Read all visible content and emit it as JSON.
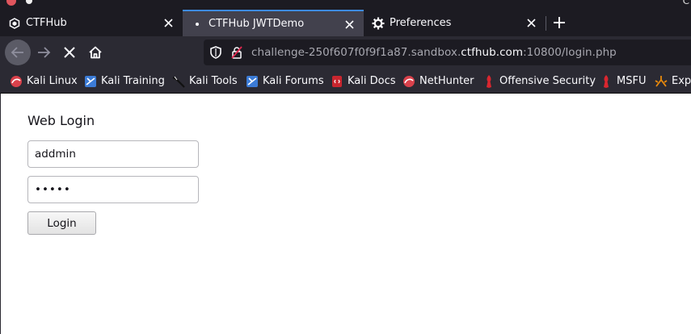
{
  "tabs": [
    {
      "label": "CTFHub",
      "icon": "ctfhub-logo-icon",
      "active": false
    },
    {
      "label": "CTFHub JWTDemo",
      "icon": "loading-dot-icon",
      "active": true
    },
    {
      "label": "Preferences",
      "icon": "gear-icon",
      "active": false
    }
  ],
  "window_edge_char": "C",
  "navbar": {
    "url_prefix": "challenge-250f607f0f9f1a87.sandbox.",
    "url_domain": "ctfhub.com",
    "url_suffix": ":10800/login.php"
  },
  "bookmarks": [
    {
      "label": "Kali Linux",
      "icon": "kali-linux-icon"
    },
    {
      "label": "Kali Training",
      "icon": "kali-training-icon"
    },
    {
      "label": "Kali Tools",
      "icon": "kali-tools-icon"
    },
    {
      "label": "Kali Forums",
      "icon": "kali-forums-icon"
    },
    {
      "label": "Kali Docs",
      "icon": "kali-docs-icon"
    },
    {
      "label": "NetHunter",
      "icon": "nethunter-icon"
    },
    {
      "label": "Offensive Security",
      "icon": "offensive-security-icon"
    },
    {
      "label": "MSFU",
      "icon": "msfu-icon"
    },
    {
      "label": "Expl",
      "icon": "exploit-db-icon"
    }
  ],
  "page": {
    "title": "Web Login",
    "username_value": "addmin",
    "password_value": "•••••",
    "login_label": "Login"
  },
  "colors": {
    "tab_bar": "#1c1b22",
    "toolbar": "#2b2a33",
    "active_tab": "#42414d",
    "accent": "#3d8be0"
  }
}
